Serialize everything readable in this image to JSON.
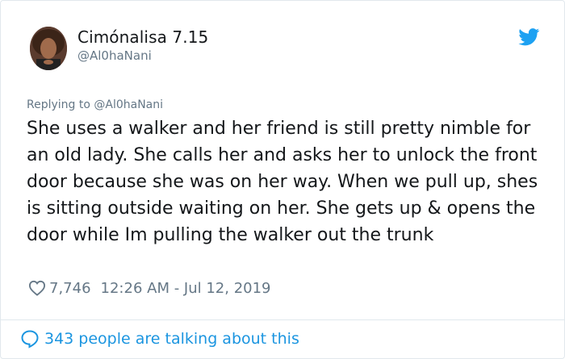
{
  "tweet": {
    "display_name": "Cimónalisa 7.15",
    "handle": "@Al0haNani",
    "replying_to": "Replying to @Al0haNani",
    "text": "She uses a walker and her friend is still pretty nimble for an old lady. She calls her and asks her to unlock the front door because she was on her way. When we pull up, shes is sitting outside waiting on her. She gets up & opens the door while Im pulling the walker out the trunk",
    "likes": "7,746",
    "timestamp": "12:26 AM - Jul 12, 2019",
    "conversation": "343 people are talking about this"
  },
  "icons": {
    "brand": "twitter-bird-icon",
    "like": "heart-icon",
    "conversation": "speech-bubble-icon"
  },
  "colors": {
    "brand": "#1da1f2",
    "link": "#1b95e0",
    "muted": "#657786",
    "text": "#14171a"
  }
}
